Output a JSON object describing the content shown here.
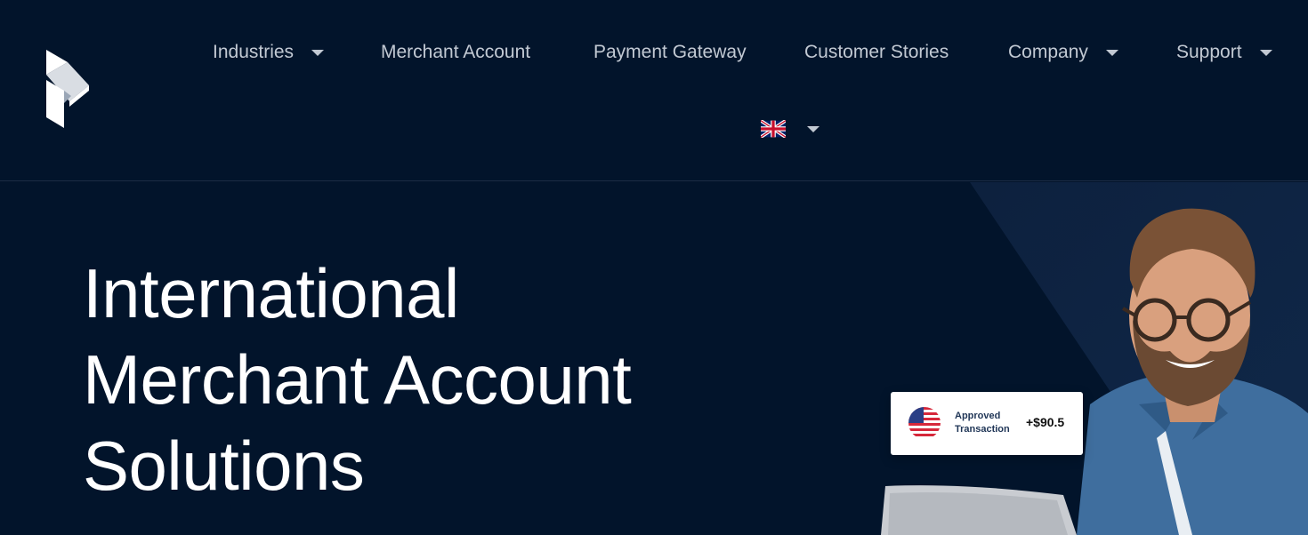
{
  "nav": {
    "items": [
      {
        "label": "Industries",
        "has_dropdown": true
      },
      {
        "label": "Merchant Account",
        "has_dropdown": false
      },
      {
        "label": "Payment Gateway",
        "has_dropdown": false
      },
      {
        "label": "Customer Stories",
        "has_dropdown": false
      },
      {
        "label": "Company",
        "has_dropdown": true
      },
      {
        "label": "Support",
        "has_dropdown": true
      }
    ],
    "language_icon": "uk-flag-icon"
  },
  "hero": {
    "title_lines": [
      "International",
      "Merchant Account",
      "Solutions"
    ]
  },
  "transaction_card": {
    "flag_icon": "us-flag-icon",
    "label_line1": "Approved",
    "label_line2": "Transaction",
    "amount": "+$90.5"
  },
  "colors": {
    "background": "#02142b",
    "nav_text": "#c2c9d3",
    "hero_text": "#ffffff",
    "card_bg": "#ffffff"
  }
}
